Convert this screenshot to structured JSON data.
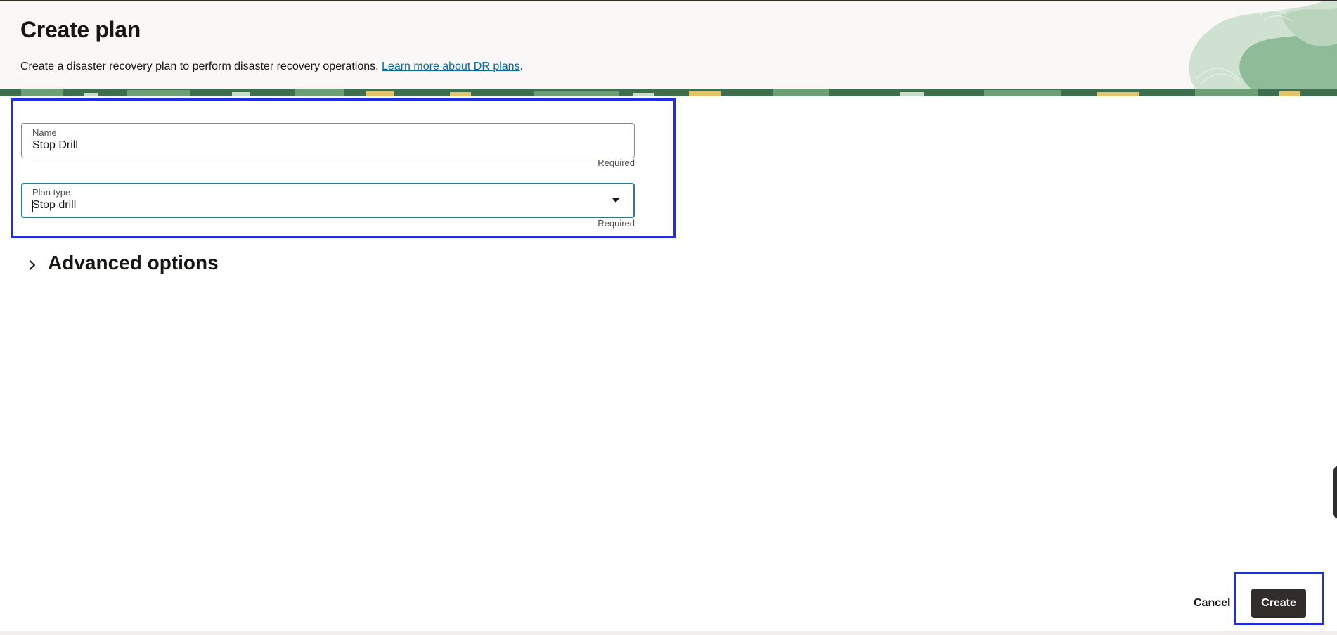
{
  "header": {
    "title": "Create plan",
    "description": "Create a disaster recovery plan to perform disaster recovery operations. ",
    "link_text": "Learn more about DR plans",
    "description_end": "."
  },
  "form": {
    "name": {
      "label": "Name",
      "value": "Stop Drill",
      "hint": "Required"
    },
    "plan_type": {
      "label": "Plan type",
      "value": "Stop drill",
      "hint": "Required"
    }
  },
  "advanced": {
    "label": "Advanced options",
    "expanded": false
  },
  "footer": {
    "cancel_label": "Cancel",
    "create_label": "Create"
  },
  "colors": {
    "primary_button": "#312d2a",
    "link": "#036ba3",
    "focus_border": "#227e9e",
    "annotation_box": "#1f2ee0"
  },
  "icons": {
    "chevron": "chevron-right-icon",
    "dropdown": "caret-down-icon"
  }
}
